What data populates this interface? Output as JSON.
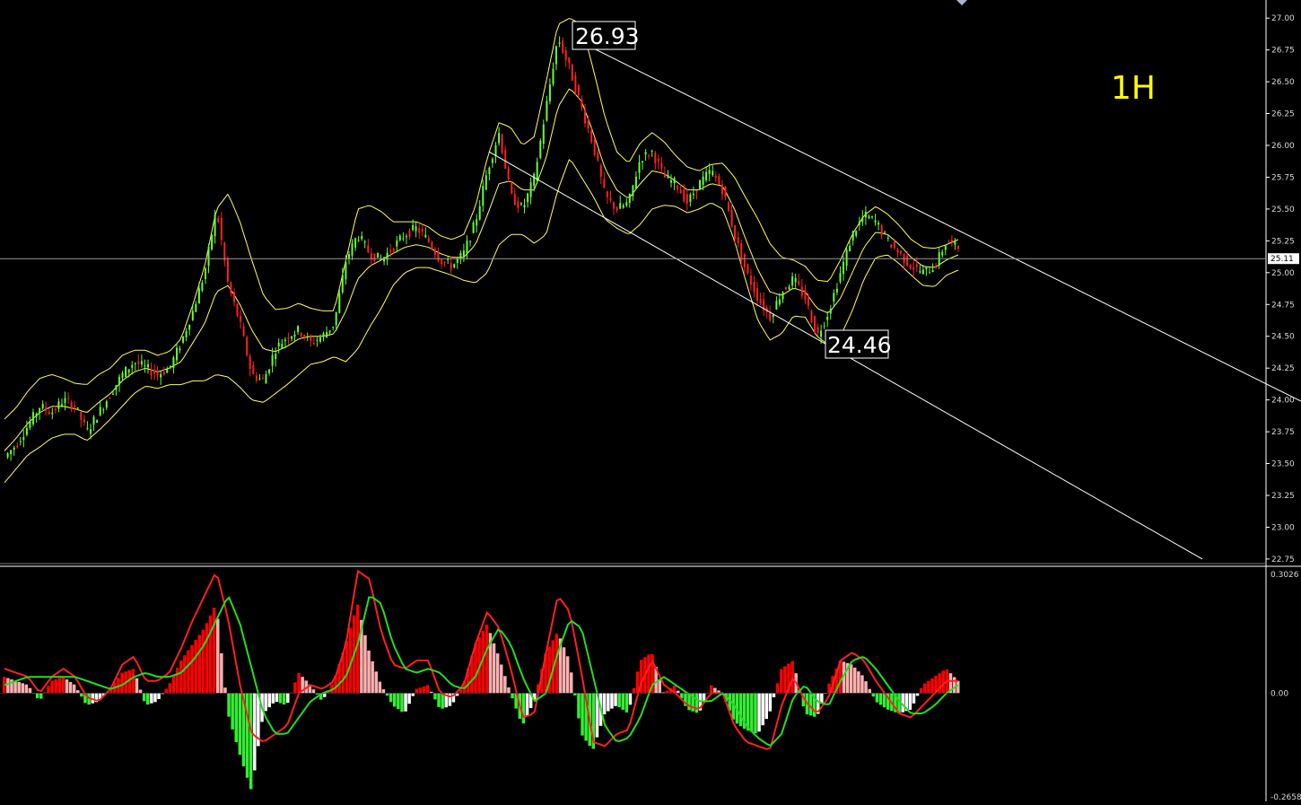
{
  "timeframe_label": "1H",
  "colors": {
    "background": "#000000",
    "axis": "#ffffff",
    "tick_text": "#d8d8d8",
    "bollinger": "#ffff55",
    "candle_up": "#66ff33",
    "candle_down": "#ff2020",
    "trend_channel": "#ffffff",
    "macd_pos_rising": "#ff0000",
    "macd_pos_falling": "#ffb0b0",
    "macd_neg_falling": "#33ee33",
    "macd_neg_rising": "#ffffff",
    "macd_line": "#ff2020",
    "signal_line": "#22dd22",
    "timeframe_label": "#ffff00"
  },
  "chart_data": [
    {
      "type": "candlestick",
      "indicator": "Bollinger Bands",
      "y_axis_ticks": [
        "27.00",
        "26.75",
        "26.50",
        "26.25",
        "26.00",
        "25.75",
        "25.50",
        "25.25",
        "25.00",
        "24.75",
        "24.50",
        "24.25",
        "24.00",
        "23.75",
        "23.50",
        "23.25",
        "23.00",
        "22.75"
      ],
      "ylim": [
        22.7,
        27.1
      ],
      "current_price": "25.11",
      "annotations": [
        {
          "text": "26.93",
          "kind": "swing-high"
        },
        {
          "text": "24.46",
          "kind": "swing-low"
        }
      ],
      "trend_channel": {
        "upper": [
          [
            26.82,
            25.27
          ],
          [
            26.82,
            23.99
          ]
        ],
        "lower": [
          [
            25.95,
            24.55
          ],
          [
            25.95,
            22.75
          ]
        ]
      },
      "price_path": [
        23.55,
        23.65,
        23.8,
        23.95,
        23.9,
        24.0,
        23.95,
        23.75,
        23.9,
        24.05,
        24.2,
        24.3,
        24.25,
        24.2,
        24.25,
        24.45,
        24.7,
        25.0,
        25.5,
        24.9,
        24.6,
        24.2,
        24.15,
        24.4,
        24.5,
        24.55,
        24.45,
        24.5,
        24.6,
        25.1,
        25.3,
        25.15,
        25.1,
        25.2,
        25.3,
        25.35,
        25.25,
        25.1,
        25.05,
        25.15,
        25.4,
        25.8,
        26.1,
        25.6,
        25.5,
        25.75,
        26.3,
        26.85,
        26.6,
        26.3,
        26.0,
        25.6,
        25.5,
        25.55,
        25.9,
        25.95,
        25.75,
        25.7,
        25.55,
        25.7,
        25.8,
        25.65,
        25.3,
        25.0,
        24.8,
        24.65,
        24.85,
        24.95,
        24.8,
        24.5,
        24.7,
        25.0,
        25.3,
        25.45,
        25.4,
        25.25,
        25.15,
        25.05,
        25.0,
        25.05,
        25.25,
        25.2
      ],
      "bands": {
        "mid": [
          23.6,
          23.7,
          23.82,
          23.9,
          23.95,
          23.95,
          23.93,
          23.9,
          23.98,
          24.05,
          24.15,
          24.22,
          24.25,
          24.22,
          24.25,
          24.3,
          24.45,
          24.6,
          24.85,
          24.9,
          24.75,
          24.55,
          24.4,
          24.38,
          24.42,
          24.48,
          24.5,
          24.5,
          24.52,
          24.7,
          24.95,
          25.05,
          25.1,
          25.15,
          25.2,
          25.22,
          25.2,
          25.15,
          25.12,
          25.12,
          25.22,
          25.45,
          25.7,
          25.72,
          25.65,
          25.65,
          25.9,
          26.3,
          26.45,
          26.35,
          26.1,
          25.82,
          25.65,
          25.58,
          25.7,
          25.8,
          25.78,
          25.72,
          25.65,
          25.65,
          25.7,
          25.68,
          25.5,
          25.25,
          25.02,
          24.85,
          24.82,
          24.88,
          24.85,
          24.72,
          24.68,
          24.8,
          25.0,
          25.2,
          25.32,
          25.3,
          25.22,
          25.12,
          25.05,
          25.04,
          25.1,
          25.14
        ],
        "width": [
          0.25,
          0.24,
          0.25,
          0.27,
          0.25,
          0.22,
          0.2,
          0.22,
          0.22,
          0.2,
          0.2,
          0.17,
          0.14,
          0.13,
          0.13,
          0.18,
          0.3,
          0.45,
          0.65,
          0.72,
          0.65,
          0.55,
          0.42,
          0.33,
          0.3,
          0.28,
          0.22,
          0.2,
          0.18,
          0.4,
          0.55,
          0.48,
          0.38,
          0.25,
          0.2,
          0.18,
          0.16,
          0.14,
          0.14,
          0.18,
          0.3,
          0.45,
          0.48,
          0.42,
          0.35,
          0.42,
          0.6,
          0.65,
          0.55,
          0.6,
          0.5,
          0.4,
          0.3,
          0.28,
          0.32,
          0.3,
          0.25,
          0.2,
          0.18,
          0.15,
          0.15,
          0.18,
          0.25,
          0.33,
          0.4,
          0.38,
          0.3,
          0.22,
          0.2,
          0.22,
          0.25,
          0.3,
          0.3,
          0.25,
          0.2,
          0.16,
          0.15,
          0.14,
          0.15,
          0.15,
          0.12,
          0.12
        ]
      }
    },
    {
      "type": "bar",
      "indicator": "MACD",
      "y_axis_ticks": [
        "0.3026",
        "0.00",
        "-0.2658"
      ],
      "ylim": [
        -0.2658,
        0.3026
      ],
      "histogram": [
        0.04,
        0.03,
        0.02,
        -0.02,
        0.03,
        0.04,
        0.02,
        -0.03,
        -0.02,
        0.01,
        0.05,
        0.06,
        -0.03,
        -0.02,
        0.02,
        0.08,
        0.12,
        0.16,
        0.22,
        -0.05,
        -0.15,
        -0.24,
        -0.05,
        -0.02,
        -0.03,
        0.05,
        0.02,
        -0.02,
        0.03,
        0.12,
        0.22,
        0.1,
        0.02,
        -0.03,
        -0.05,
        0.01,
        0.02,
        -0.04,
        -0.03,
        0.02,
        0.12,
        0.17,
        0.09,
        0.0,
        -0.08,
        -0.02,
        0.1,
        0.15,
        0.08,
        -0.1,
        -0.14,
        -0.05,
        -0.03,
        -0.05,
        0.08,
        0.1,
        0.0,
        0.02,
        -0.04,
        -0.05,
        0.02,
        0.0,
        -0.07,
        -0.09,
        -0.1,
        -0.05,
        0.06,
        0.08,
        -0.05,
        -0.06,
        0.02,
        0.08,
        0.07,
        0.04,
        -0.02,
        -0.04,
        -0.05,
        -0.04,
        0.02,
        0.04,
        0.06,
        0.03
      ],
      "macd": [
        0.06,
        0.05,
        0.04,
        0.0,
        0.04,
        0.06,
        0.04,
        -0.01,
        -0.02,
        0.01,
        0.07,
        0.09,
        0.03,
        0.03,
        0.05,
        0.11,
        0.18,
        0.24,
        0.3,
        0.18,
        0.02,
        -0.1,
        -0.12,
        -0.1,
        -0.08,
        0.0,
        0.02,
        0.01,
        0.03,
        0.12,
        0.3,
        0.28,
        0.15,
        0.07,
        0.06,
        0.08,
        0.08,
        0.0,
        -0.01,
        0.02,
        0.12,
        0.2,
        0.16,
        0.06,
        -0.06,
        -0.05,
        0.1,
        0.24,
        0.2,
        0.05,
        -0.12,
        -0.13,
        -0.1,
        -0.09,
        0.02,
        0.08,
        0.02,
        0.0,
        -0.03,
        -0.04,
        0.0,
        0.0,
        -0.08,
        -0.12,
        -0.13,
        -0.14,
        -0.03,
        0.04,
        -0.02,
        -0.05,
        -0.01,
        0.08,
        0.1,
        0.08,
        0.03,
        -0.01,
        -0.05,
        -0.06,
        -0.03,
        0.0,
        0.03,
        0.03
      ],
      "signal": [
        0.02,
        0.03,
        0.04,
        0.04,
        0.04,
        0.04,
        0.04,
        0.03,
        0.02,
        0.01,
        0.02,
        0.04,
        0.05,
        0.04,
        0.04,
        0.05,
        0.08,
        0.12,
        0.18,
        0.24,
        0.17,
        0.06,
        -0.05,
        -0.1,
        -0.1,
        -0.06,
        -0.02,
        0.0,
        0.01,
        0.04,
        0.12,
        0.24,
        0.22,
        0.12,
        0.06,
        0.05,
        0.06,
        0.05,
        0.02,
        0.01,
        0.04,
        0.11,
        0.16,
        0.12,
        0.04,
        -0.02,
        0.0,
        0.1,
        0.18,
        0.16,
        0.04,
        -0.08,
        -0.12,
        -0.11,
        -0.06,
        0.02,
        0.04,
        0.02,
        0.0,
        -0.02,
        -0.02,
        0.0,
        -0.03,
        -0.08,
        -0.11,
        -0.13,
        -0.1,
        -0.01,
        0.02,
        -0.02,
        -0.03,
        0.03,
        0.08,
        0.09,
        0.06,
        0.02,
        -0.02,
        -0.05,
        -0.05,
        -0.03,
        0.0,
        0.02
      ]
    }
  ]
}
